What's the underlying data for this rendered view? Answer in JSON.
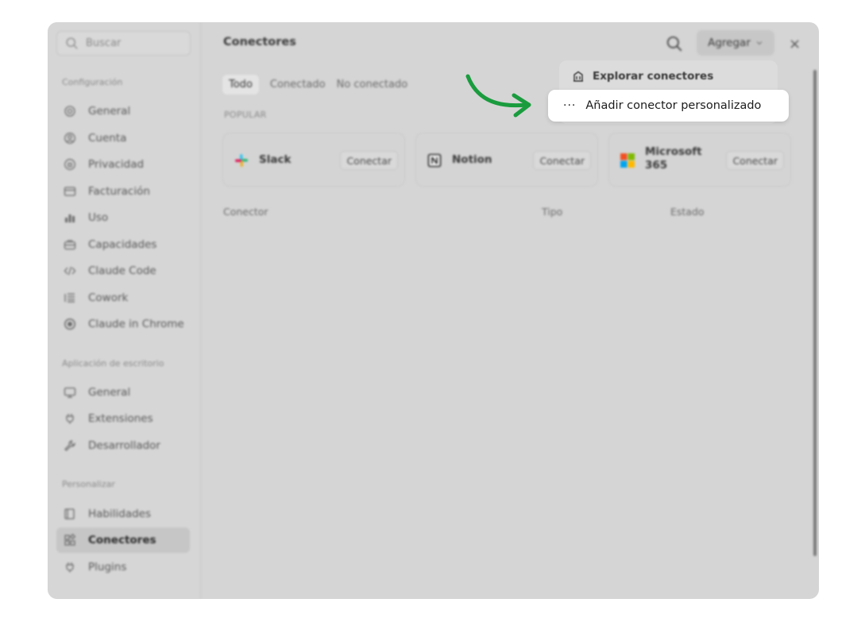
{
  "sidebar": {
    "search_placeholder": "Buscar",
    "sections": {
      "config": "Configuración",
      "desktop": "Aplicación de escritorio",
      "personalize": "Personalizar"
    },
    "items": [
      {
        "label": "General",
        "icon": "gear-icon"
      },
      {
        "label": "Cuenta",
        "icon": "user-circle-icon"
      },
      {
        "label": "Privacidad",
        "icon": "shield-icon"
      },
      {
        "label": "Facturación",
        "icon": "credit-card-icon"
      },
      {
        "label": "Uso",
        "icon": "bar-chart-icon"
      },
      {
        "label": "Capacidades",
        "icon": "briefcase-icon"
      },
      {
        "label": "Claude Code",
        "icon": "code-icon"
      },
      {
        "label": "Cowork",
        "icon": "list-icon"
      },
      {
        "label": "Claude in Chrome",
        "icon": "globe-icon"
      },
      {
        "label": "General",
        "icon": "monitor-icon"
      },
      {
        "label": "Extensiones",
        "icon": "plug-icon"
      },
      {
        "label": "Desarrollador",
        "icon": "wrench-icon"
      },
      {
        "label": "Habilidades",
        "icon": "book-icon"
      },
      {
        "label": "Conectores",
        "icon": "connectors-icon"
      },
      {
        "label": "Plugins",
        "icon": "plug-icon"
      }
    ]
  },
  "header": {
    "title": "Conectores",
    "add_label": "Agregar",
    "close": "×"
  },
  "tabs": [
    "Todo",
    "Conectado",
    "No conectado"
  ],
  "popular_label": "POPULAR",
  "cards": [
    {
      "name": "Slack",
      "button": "Conectar",
      "icon": "slack-logo"
    },
    {
      "name": "Notion",
      "button": "Conectar",
      "icon": "notion-logo"
    },
    {
      "name": "Microsoft 365",
      "button": "Conectar",
      "icon": "microsoft-logo"
    }
  ],
  "table_headers": [
    "Conector",
    "Tipo",
    "Estado"
  ],
  "menu": {
    "browse": "Explorar conectores",
    "dots": "···",
    "add_custom": "Añadir conector personalizado"
  },
  "colors": {
    "arrow": "#1a9c3e",
    "window_bg": "#d5d5d5"
  }
}
